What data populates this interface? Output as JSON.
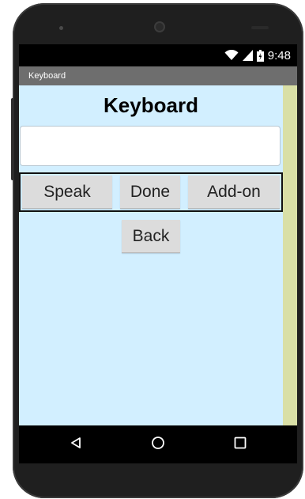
{
  "status_bar": {
    "time": "9:48",
    "icons": [
      "wifi-icon",
      "signal-icon",
      "battery-icon"
    ]
  },
  "app": {
    "title_bar": "Keyboard",
    "heading": "Keyboard"
  },
  "input": {
    "value": "",
    "placeholder": ""
  },
  "buttons": {
    "speak": "Speak",
    "done": "Done",
    "addon": "Add-on",
    "back": "Back"
  },
  "nav_bar": {
    "icons": [
      "back-triangle-icon",
      "home-circle-icon",
      "recent-square-icon"
    ]
  },
  "colors": {
    "screen_bg": "#d2efff",
    "scroll_strip": "#d9dfa6",
    "title_bar": "#6e6e6e",
    "button_bg": "#dcdcdc"
  }
}
